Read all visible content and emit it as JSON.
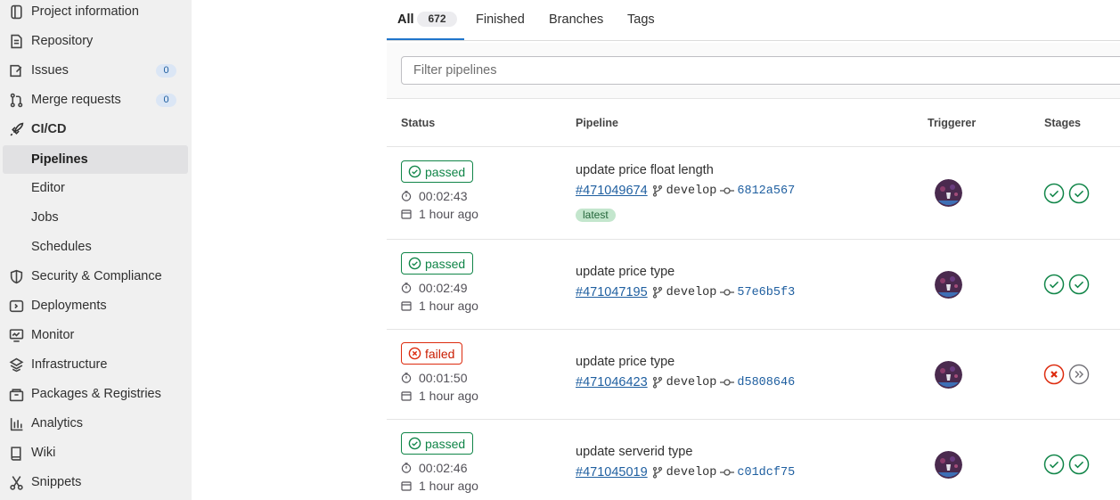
{
  "sidebar": {
    "items": [
      {
        "label": "Project information",
        "icon": "project-info-icon"
      },
      {
        "label": "Repository",
        "icon": "repository-icon"
      },
      {
        "label": "Issues",
        "icon": "issues-icon",
        "count": "0"
      },
      {
        "label": "Merge requests",
        "icon": "merge-request-icon",
        "count": "0"
      },
      {
        "label": "CI/CD",
        "icon": "rocket-icon"
      },
      {
        "label": "Pipelines"
      },
      {
        "label": "Editor"
      },
      {
        "label": "Jobs"
      },
      {
        "label": "Schedules"
      },
      {
        "label": "Security & Compliance",
        "icon": "shield-icon"
      },
      {
        "label": "Deployments",
        "icon": "deployments-icon"
      },
      {
        "label": "Monitor",
        "icon": "monitor-icon"
      },
      {
        "label": "Infrastructure",
        "icon": "infrastructure-icon"
      },
      {
        "label": "Packages & Registries",
        "icon": "package-icon"
      },
      {
        "label": "Analytics",
        "icon": "analytics-icon"
      },
      {
        "label": "Wiki",
        "icon": "book-icon"
      },
      {
        "label": "Snippets",
        "icon": "scissors-icon"
      }
    ]
  },
  "tabs": [
    {
      "label": "All",
      "count": "672",
      "active": true
    },
    {
      "label": "Finished"
    },
    {
      "label": "Branches"
    },
    {
      "label": "Tags"
    }
  ],
  "filter": {
    "placeholder": "Filter pipelines"
  },
  "table": {
    "headers": {
      "status": "Status",
      "pipeline": "Pipeline",
      "triggerer": "Triggerer",
      "stages": "Stages"
    },
    "rows": [
      {
        "status": "passed",
        "duration": "00:02:43",
        "finished": "1 hour ago",
        "title": "update price float length",
        "id": "#471049674",
        "branch": "develop",
        "sha": "6812a567",
        "badge": "latest",
        "stages": [
          "success",
          "success"
        ]
      },
      {
        "status": "passed",
        "duration": "00:02:49",
        "finished": "1 hour ago",
        "title": "update price type",
        "id": "#471047195",
        "branch": "develop",
        "sha": "57e6b5f3",
        "stages": [
          "success",
          "success"
        ]
      },
      {
        "status": "failed",
        "duration": "00:01:50",
        "finished": "1 hour ago",
        "title": "update price type",
        "id": "#471046423",
        "branch": "develop",
        "sha": "d5808646",
        "stages": [
          "failed",
          "skipped"
        ]
      },
      {
        "status": "passed",
        "duration": "00:02:46",
        "finished": "1 hour ago",
        "title": "update serverid type",
        "id": "#471045019",
        "branch": "develop",
        "sha": "c01dcf75",
        "stages": [
          "success",
          "success"
        ]
      }
    ]
  },
  "colors": {
    "success": "#108548",
    "failed": "#dd2b0e",
    "link": "#1f5fa0",
    "accent": "#1f75cb",
    "sidebar_bg": "#f0f0f0"
  }
}
